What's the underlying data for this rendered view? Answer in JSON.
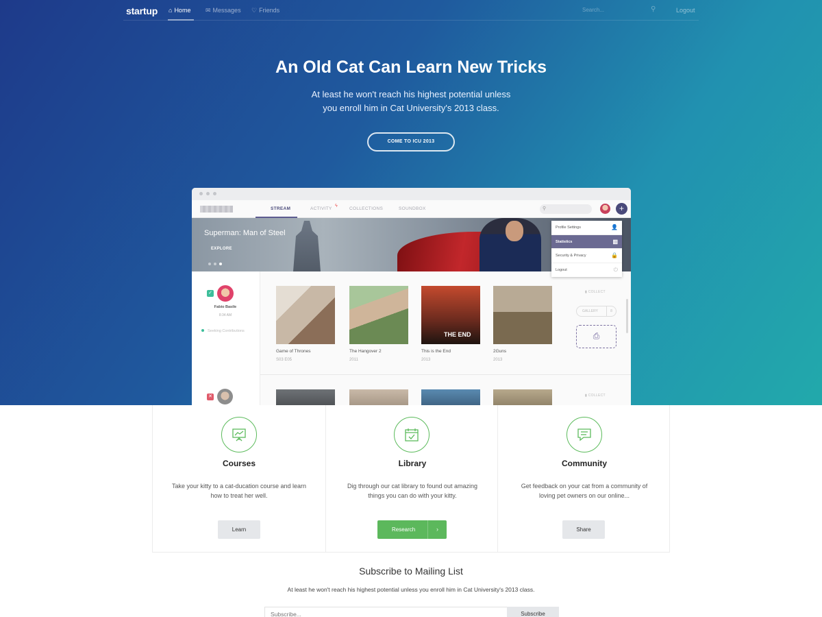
{
  "nav": {
    "brand": "startup",
    "items": [
      {
        "label": "Home",
        "icon": "home-icon",
        "active": true
      },
      {
        "label": "Messages",
        "icon": "envelope-icon",
        "active": false
      },
      {
        "label": "Friends",
        "icon": "heart-icon",
        "active": false
      }
    ],
    "search_placeholder": "Search...",
    "logout_label": "Logout"
  },
  "hero": {
    "title": "An Old Cat Can Learn New Tricks",
    "subtitle_line1": "At least he won't reach his highest potential unless",
    "subtitle_line2": "you enroll him in Cat University's 2013 class.",
    "cta_label": "COME TO ICU 2013"
  },
  "mockup": {
    "tabs": [
      "STREAM",
      "ACTIVITY",
      "COLLECTIONS",
      "SOUNDBOX"
    ],
    "banner": {
      "title": "Superman: Man of Steel",
      "explore_label": "EXPLORE"
    },
    "dropdown": [
      {
        "label": "Profile Settings",
        "icon": "user-icon"
      },
      {
        "label": "Statistics",
        "icon": "bar-chart-icon",
        "active": true
      },
      {
        "label": "Security & Privacy",
        "icon": "lock-icon"
      },
      {
        "label": "Logout",
        "icon": "power-icon"
      }
    ],
    "sidebar": {
      "user_name": "Fabio Basile",
      "time": "8:34 AM",
      "status": "Seeking Contributions"
    },
    "cards": [
      {
        "title": "Game of Thrones",
        "sub": "S03 E05"
      },
      {
        "title": "The Hangover 2",
        "sub": "2011"
      },
      {
        "title": "This is the End",
        "sub": "2013"
      },
      {
        "title": "2Guns",
        "sub": "2013"
      }
    ],
    "thumb_text": "THE END",
    "collect_label": "COLLECT",
    "gallery_label": "GALLERY",
    "gallery_count": "8"
  },
  "features": [
    {
      "title": "Courses",
      "desc": "Take your kitty to a cat-ducation course and learn how to treat her well.",
      "button": "Learn",
      "icon": "presentation-board-icon"
    },
    {
      "title": "Library",
      "desc": "Dig through our cat library to found out amazing things you can do with your kitty.",
      "button": "Research",
      "icon": "calendar-check-icon"
    },
    {
      "title": "Community",
      "desc": "Get feedback on your cat from a community of loving pet owners on our online...",
      "button": "Share",
      "icon": "chat-bubble-icon"
    }
  ],
  "subscribe": {
    "title": "Subscribe to Mailing List",
    "desc": "At least he won't reach his highest potential unless you enroll him in Cat University's 2013 class.",
    "placeholder": "Subscribe...",
    "button": "Subscribe"
  },
  "colors": {
    "accent_green": "#5cb85c",
    "hero_start": "#1e3a8a",
    "hero_end": "#22a9ab",
    "mock_purple": "#4a4a7a"
  }
}
